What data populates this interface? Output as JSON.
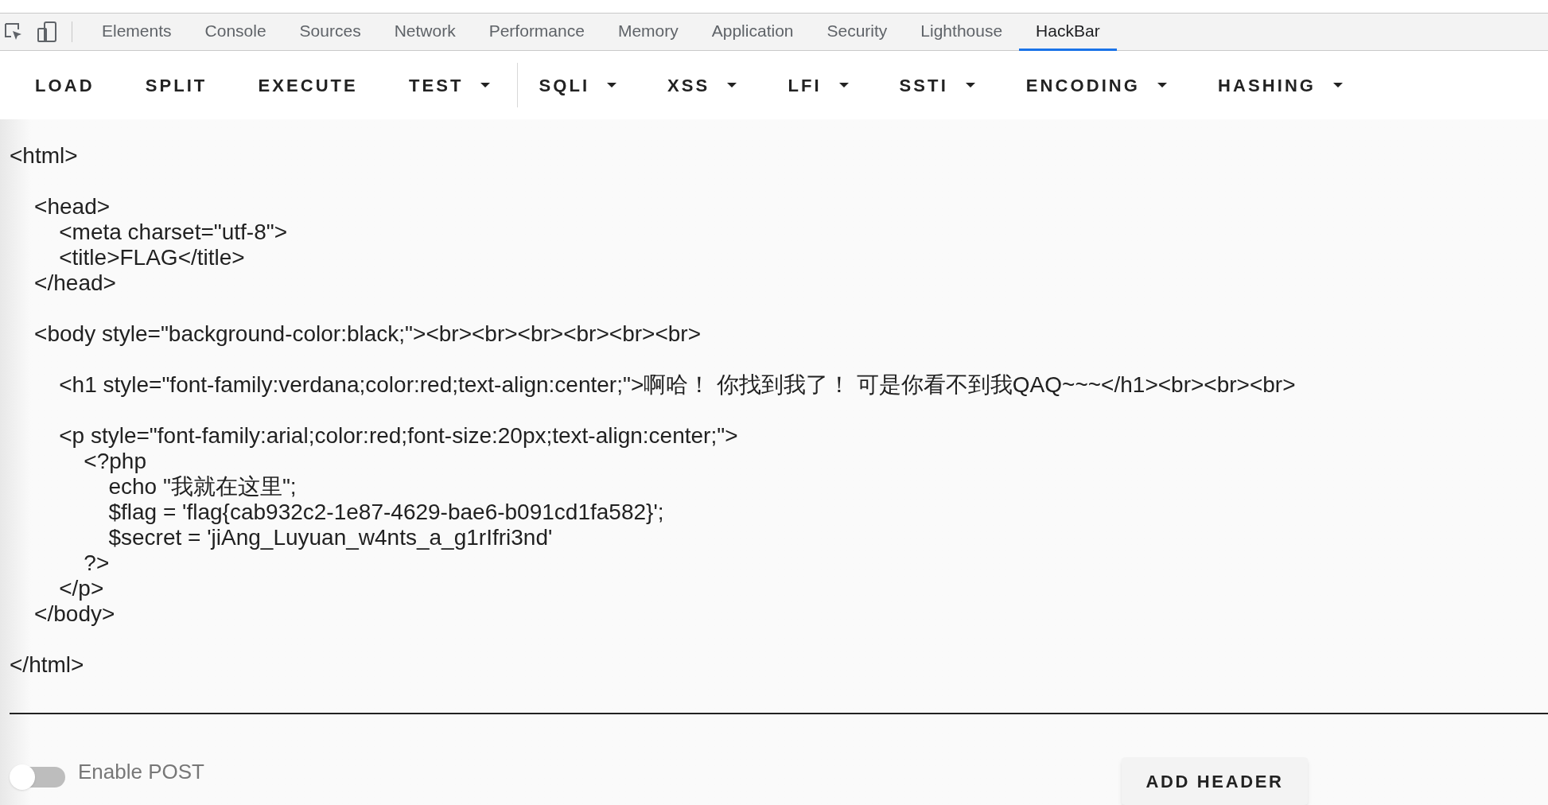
{
  "devtools_tabs": [
    {
      "label": "Elements",
      "selected": false
    },
    {
      "label": "Console",
      "selected": false
    },
    {
      "label": "Sources",
      "selected": false
    },
    {
      "label": "Network",
      "selected": false
    },
    {
      "label": "Performance",
      "selected": false
    },
    {
      "label": "Memory",
      "selected": false
    },
    {
      "label": "Application",
      "selected": false
    },
    {
      "label": "Security",
      "selected": false
    },
    {
      "label": "Lighthouse",
      "selected": false
    },
    {
      "label": "HackBar",
      "selected": true
    }
  ],
  "toolbar": [
    {
      "label": "LOAD",
      "dropdown": false
    },
    {
      "label": "SPLIT",
      "dropdown": false
    },
    {
      "label": "EXECUTE",
      "dropdown": false
    },
    {
      "label": "TEST",
      "dropdown": true
    },
    {
      "label": "SQLI",
      "dropdown": true
    },
    {
      "label": "XSS",
      "dropdown": true
    },
    {
      "label": "LFI",
      "dropdown": true
    },
    {
      "label": "SSTI",
      "dropdown": true
    },
    {
      "label": "ENCODING",
      "dropdown": true
    },
    {
      "label": "HASHING",
      "dropdown": true
    }
  ],
  "editor": {
    "value": "<html>\n\n    <head>\n        <meta charset=\"utf-8\">\n        <title>FLAG</title>\n    </head>\n\n    <body style=\"background-color:black;\"><br><br><br><br><br><br>\n\n        <h1 style=\"font-family:verdana;color:red;text-align:center;\">啊哈！ 你找到我了！ 可是你看不到我QAQ~~~</h1><br><br><br>\n\n        <p style=\"font-family:arial;color:red;font-size:20px;text-align:center;\">\n            <?php\n                echo \"我就在这里\";\n                $flag = 'flag{cab932c2-1e87-4629-bae6-b091cd1fa582}';\n                $secret = 'jiAng_Luyuan_w4nts_a_g1rIfri3nd'\n            ?>\n        </p>\n    </body>\n\n</html>"
  },
  "enable_post": {
    "label": "Enable POST",
    "on": false
  },
  "add_header_button": {
    "label": "ADD HEADER"
  }
}
